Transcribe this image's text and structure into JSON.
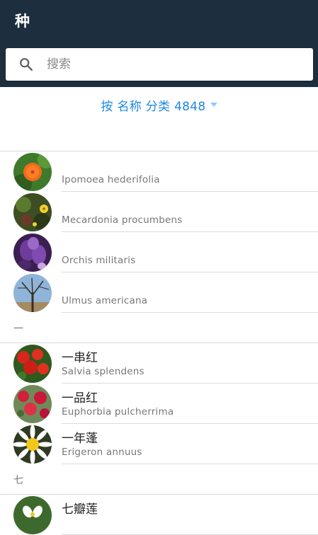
{
  "appbar": {
    "title": "种",
    "color": "#1d2f3f"
  },
  "search": {
    "placeholder": "搜索",
    "icon": "search-icon"
  },
  "sort": {
    "label": "按 名称 分类 4848",
    "color": "#1e88e5"
  },
  "groups": [
    {
      "header": "",
      "items": [
        {
          "name_cn": "",
          "name_lat": "Ipomoea hederifolia",
          "image": "orange-flower"
        },
        {
          "name_cn": "",
          "name_lat": "Mecardonia procumbens",
          "image": "yellow-flower"
        },
        {
          "name_cn": "",
          "name_lat": "Orchis militaris",
          "image": "purple-orchid"
        },
        {
          "name_cn": "",
          "name_lat": "Ulmus americana",
          "image": "elm-tree"
        }
      ]
    },
    {
      "header": "一",
      "items": [
        {
          "name_cn": "一串红",
          "name_lat": "Salvia splendens",
          "image": "red-salvia"
        },
        {
          "name_cn": "一品红",
          "name_lat": "Euphorbia pulcherrima",
          "image": "red-poinsettia"
        },
        {
          "name_cn": "一年蓬",
          "name_lat": "Erigeron annuus",
          "image": "white-daisy"
        }
      ]
    },
    {
      "header": "七",
      "items": [
        {
          "name_cn": "七瓣莲",
          "name_lat": "",
          "image": "white-flower"
        }
      ]
    }
  ]
}
